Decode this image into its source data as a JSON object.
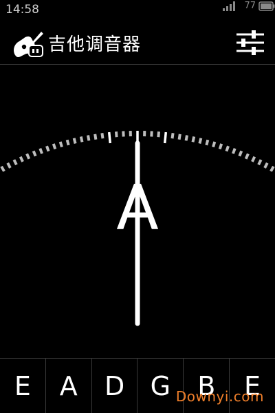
{
  "status": {
    "time": "14:58",
    "battery_level": "77",
    "icons": [
      "signal-icon",
      "battery-icon"
    ]
  },
  "app": {
    "title": "吉他调音器",
    "icon": "guitar-icon",
    "settings_icon": "sliders-icon"
  },
  "tuner": {
    "note": "A",
    "needle_deviation_fraction": 0.0
  },
  "strings": [
    {
      "label": "E"
    },
    {
      "label": "A"
    },
    {
      "label": "D"
    },
    {
      "label": "G"
    },
    {
      "label": "B"
    },
    {
      "label": "E"
    }
  ],
  "watermark": "Downyi.com",
  "colors": {
    "background": "#000000",
    "foreground": "#ffffff",
    "tick": "#bdbdbd",
    "watermark": "#f07f2a"
  }
}
